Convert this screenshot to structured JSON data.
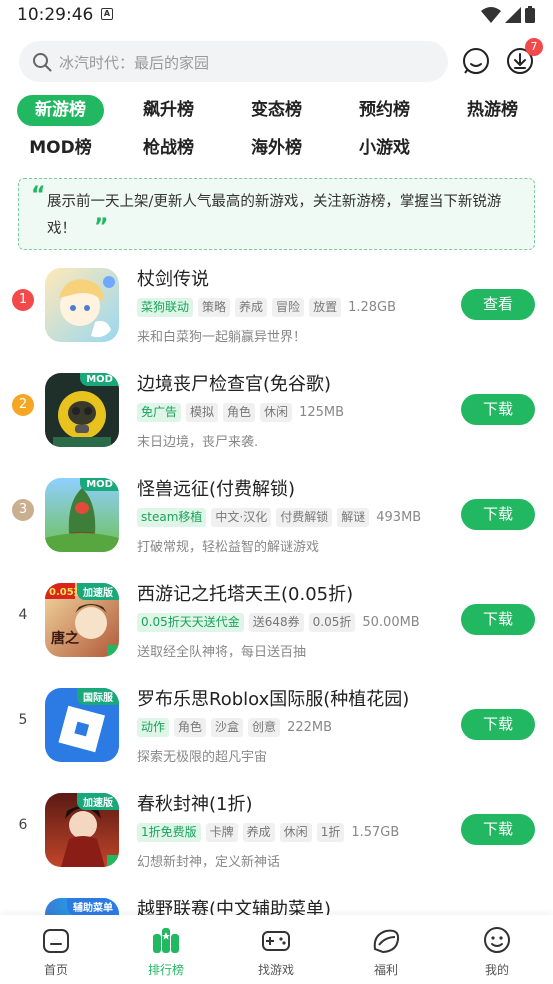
{
  "status_bar": {
    "time": "10:29:46",
    "badge_letter": "A"
  },
  "search": {
    "placeholder": "冰汽时代：最后的家园",
    "badge_count": "7"
  },
  "tabs": [
    {
      "label": "新游榜",
      "active": true
    },
    {
      "label": "飙升榜"
    },
    {
      "label": "变态榜"
    },
    {
      "label": "预约榜"
    },
    {
      "label": "热游榜"
    },
    {
      "label": "MOD榜"
    },
    {
      "label": "枪战榜"
    },
    {
      "label": "海外榜"
    },
    {
      "label": "小游戏"
    }
  ],
  "notice": {
    "text": "展示前一天上架/更新人气最高的新游戏，关注新游榜，掌握当下新锐游戏！"
  },
  "games": [
    {
      "rank": "1",
      "title": "杖剑传说",
      "tags": [
        "菜狗联动",
        "策略",
        "养成",
        "冒险",
        "放置"
      ],
      "size": "1.28GB",
      "desc": "来和白菜狗一起躺赢异世界！",
      "action": "查看",
      "badge": ""
    },
    {
      "rank": "2",
      "title": "边境丧尸检查官(免谷歌)",
      "tags": [
        "免广告",
        "模拟",
        "角色",
        "休闲"
      ],
      "size": "125MB",
      "desc": "末日边境，丧尸来袭.",
      "action": "下载",
      "badge": "MOD"
    },
    {
      "rank": "3",
      "title": "怪兽远征(付费解锁)",
      "tags": [
        "steam移植",
        "中文·汉化",
        "付费解锁",
        "解谜"
      ],
      "size": "493MB",
      "desc": "打破常规，轻松益智的解谜游戏",
      "action": "下载",
      "badge": "MOD"
    },
    {
      "rank": "4",
      "title": "西游记之托塔天王(0.05折)",
      "tags": [
        "0.05折天天送代金",
        "送648券",
        "0.05折"
      ],
      "size": "50.00MB",
      "desc": "送取经全队神将，每日送百抽",
      "action": "下载",
      "badge": "加速版"
    },
    {
      "rank": "5",
      "title": "罗布乐思Roblox国际服(种植花园)",
      "tags": [
        "动作",
        "角色",
        "沙盒",
        "创意"
      ],
      "size": "222MB",
      "desc": "探索无极限的超凡宇宙",
      "action": "下载",
      "badge": "国际服"
    },
    {
      "rank": "6",
      "title": "春秋封神(1折)",
      "tags": [
        "1折免费版",
        "卡牌",
        "养成",
        "休闲",
        "1折"
      ],
      "size": "1.57GB",
      "desc": "幻想新封神，定义新神话",
      "action": "下载",
      "badge": "加速版"
    },
    {
      "rank": "",
      "title": "越野联赛(中文辅助菜单)",
      "tags": [],
      "size": "",
      "desc": "",
      "action": "",
      "badge": "辅助菜单"
    }
  ],
  "bottom_nav": [
    {
      "label": "首页",
      "icon": "home-icon"
    },
    {
      "label": "排行榜",
      "icon": "ranking-icon",
      "active": true
    },
    {
      "label": "找游戏",
      "icon": "gamepad-icon"
    },
    {
      "label": "福利",
      "icon": "gift-icon"
    },
    {
      "label": "我的",
      "icon": "profile-icon"
    }
  ],
  "colors": {
    "accent": "#22b862",
    "rank1": "#f24a4a",
    "rank2": "#f5a623",
    "rank3": "#c9ae90"
  }
}
